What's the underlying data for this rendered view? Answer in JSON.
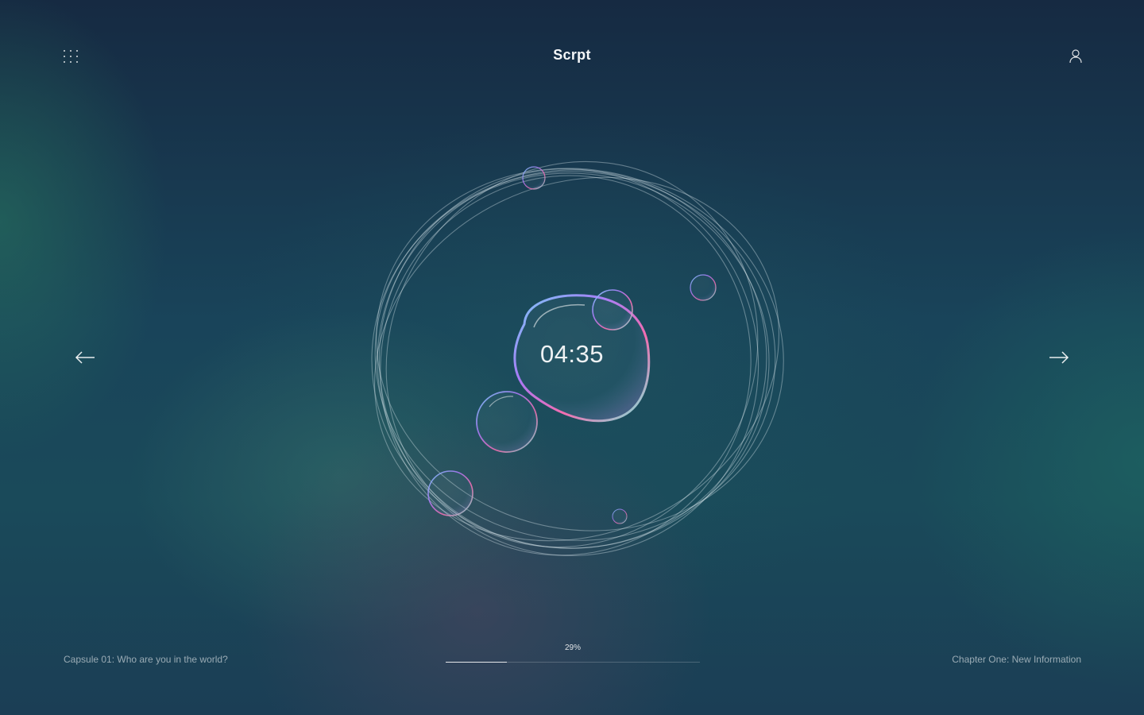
{
  "header": {
    "brand": "Scrpt",
    "menu_icon": "grid-dots-icon",
    "user_icon": "user-icon"
  },
  "navigation": {
    "prev_icon": "arrow-left-icon",
    "next_icon": "arrow-right-icon"
  },
  "main": {
    "timer": "04:35",
    "visual_icon": "bubble-orbit-icon"
  },
  "footer": {
    "capsule": "Capsule 01: Who are you in the world?",
    "chapter": "Chapter One: New Information",
    "progress_label": "29%",
    "progress_value": 0.24
  },
  "colors": {
    "text": "#ffffff",
    "muted_text": "#a9b9c2",
    "background_top": "#162a42",
    "background_mid": "#1a4a5a"
  }
}
